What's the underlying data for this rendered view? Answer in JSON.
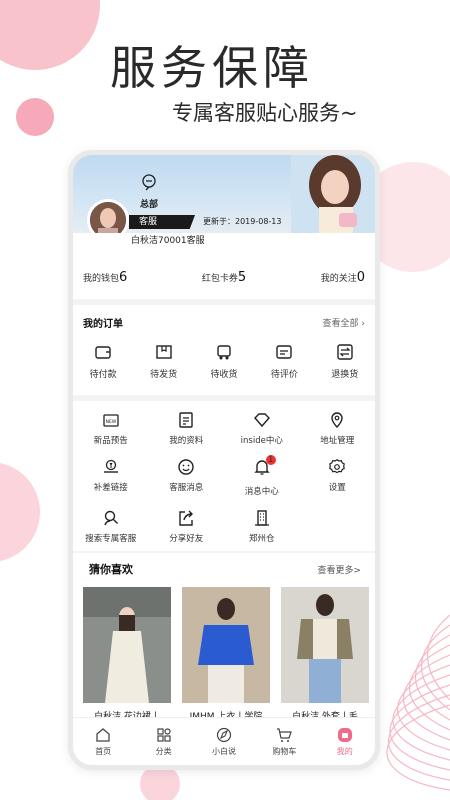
{
  "hero": {
    "title": "服务保障",
    "subtitle": "专属客服贴心服务~"
  },
  "profile": {
    "hq_label": "总部",
    "role_tag": "客服",
    "updated": "更新于：2019-08-13",
    "store_name": "白秋洁70001客服"
  },
  "stats": [
    {
      "label": "我的钱包",
      "value": "6"
    },
    {
      "label": "红包卡券",
      "value": "5"
    },
    {
      "label": "我的关注",
      "value": "0"
    }
  ],
  "orders": {
    "title": "我的订单",
    "view_all": "查看全部",
    "items": [
      {
        "label": "待付款",
        "icon": "wallet-icon"
      },
      {
        "label": "待发货",
        "icon": "box-icon"
      },
      {
        "label": "待收货",
        "icon": "truck-icon"
      },
      {
        "label": "待评价",
        "icon": "review-icon"
      },
      {
        "label": "退换货",
        "icon": "exchange-icon"
      }
    ]
  },
  "tools": [
    {
      "label": "新品预告",
      "icon": "new-icon"
    },
    {
      "label": "我的资料",
      "icon": "profile-doc-icon"
    },
    {
      "label": "inside中心",
      "icon": "diamond-icon"
    },
    {
      "label": "地址管理",
      "icon": "location-icon"
    },
    {
      "label": "补差链接",
      "icon": "money-hand-icon"
    },
    {
      "label": "客服消息",
      "icon": "smile-icon"
    },
    {
      "label": "消息中心",
      "icon": "bell-icon",
      "badge": "1"
    },
    {
      "label": "设置",
      "icon": "gear-icon"
    },
    {
      "label": "搜索专属客服",
      "icon": "search-user-icon"
    },
    {
      "label": "分享好友",
      "icon": "share-icon"
    },
    {
      "label": "郑州仓",
      "icon": "warehouse-icon"
    }
  ],
  "guess": {
    "title": "猜你喜欢",
    "more": "查看更多>",
    "products": [
      {
        "title": "白秋洁 花边裙丨"
      },
      {
        "title": "IMHM 上衣丨学院"
      },
      {
        "title": "白秋洁 外套丨毛"
      }
    ]
  },
  "tabbar": [
    {
      "label": "首页",
      "icon": "home-icon"
    },
    {
      "label": "分类",
      "icon": "category-icon"
    },
    {
      "label": "小白说",
      "icon": "compass-icon"
    },
    {
      "label": "购物车",
      "icon": "cart-icon"
    },
    {
      "label": "我的",
      "icon": "me-icon",
      "active": true
    }
  ],
  "colors": {
    "accent": "#f06a8a",
    "deco_pink": "#f9c3cc"
  }
}
